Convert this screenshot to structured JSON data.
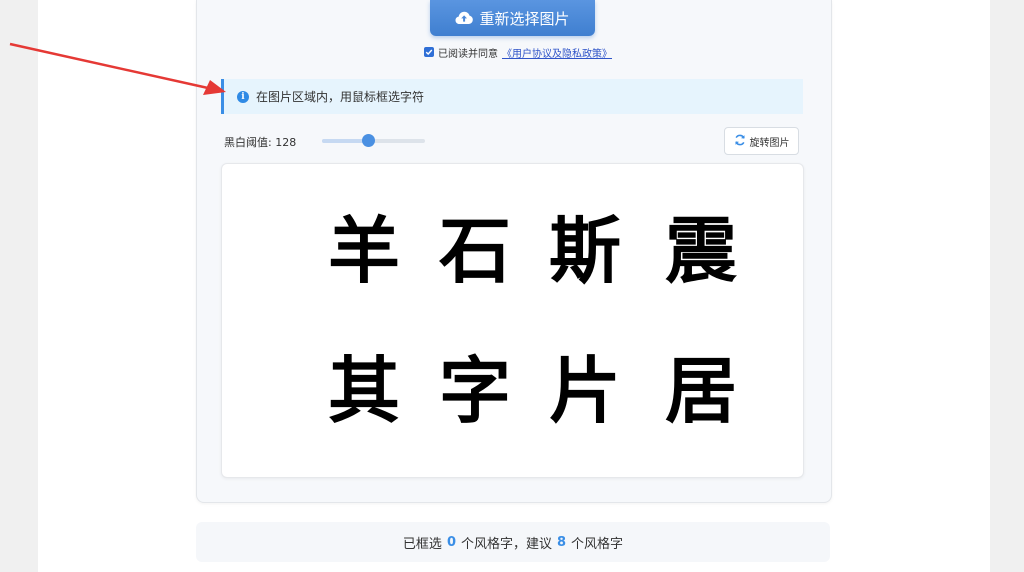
{
  "upload": {
    "reselect_label": "重新选择图片",
    "agree_text": "已阅读并同意",
    "agree_link": "《用户协议及隐私政策》",
    "agree_checked": true
  },
  "tip": {
    "text": "在图片区域内，用鼠标框选字符",
    "icon": "info-icon"
  },
  "controls": {
    "threshold_label": "黑白阈值:",
    "threshold_value": "128",
    "threshold_fraction": 0.45,
    "rotate_label": "旋转图片",
    "rotate_icon": "refresh-icon"
  },
  "image": {
    "characters": [
      "羊",
      "石",
      "斯",
      "震",
      "其",
      "字",
      "片",
      "居"
    ]
  },
  "status": {
    "prefix": "已框选",
    "selected_count": "0",
    "middle": "个风格字，建议",
    "suggested_count": "8",
    "suffix": "个风格字"
  },
  "colors": {
    "accent": "#3a8ee6",
    "button": "#4a88d8",
    "annotation_arrow": "#e53935"
  }
}
